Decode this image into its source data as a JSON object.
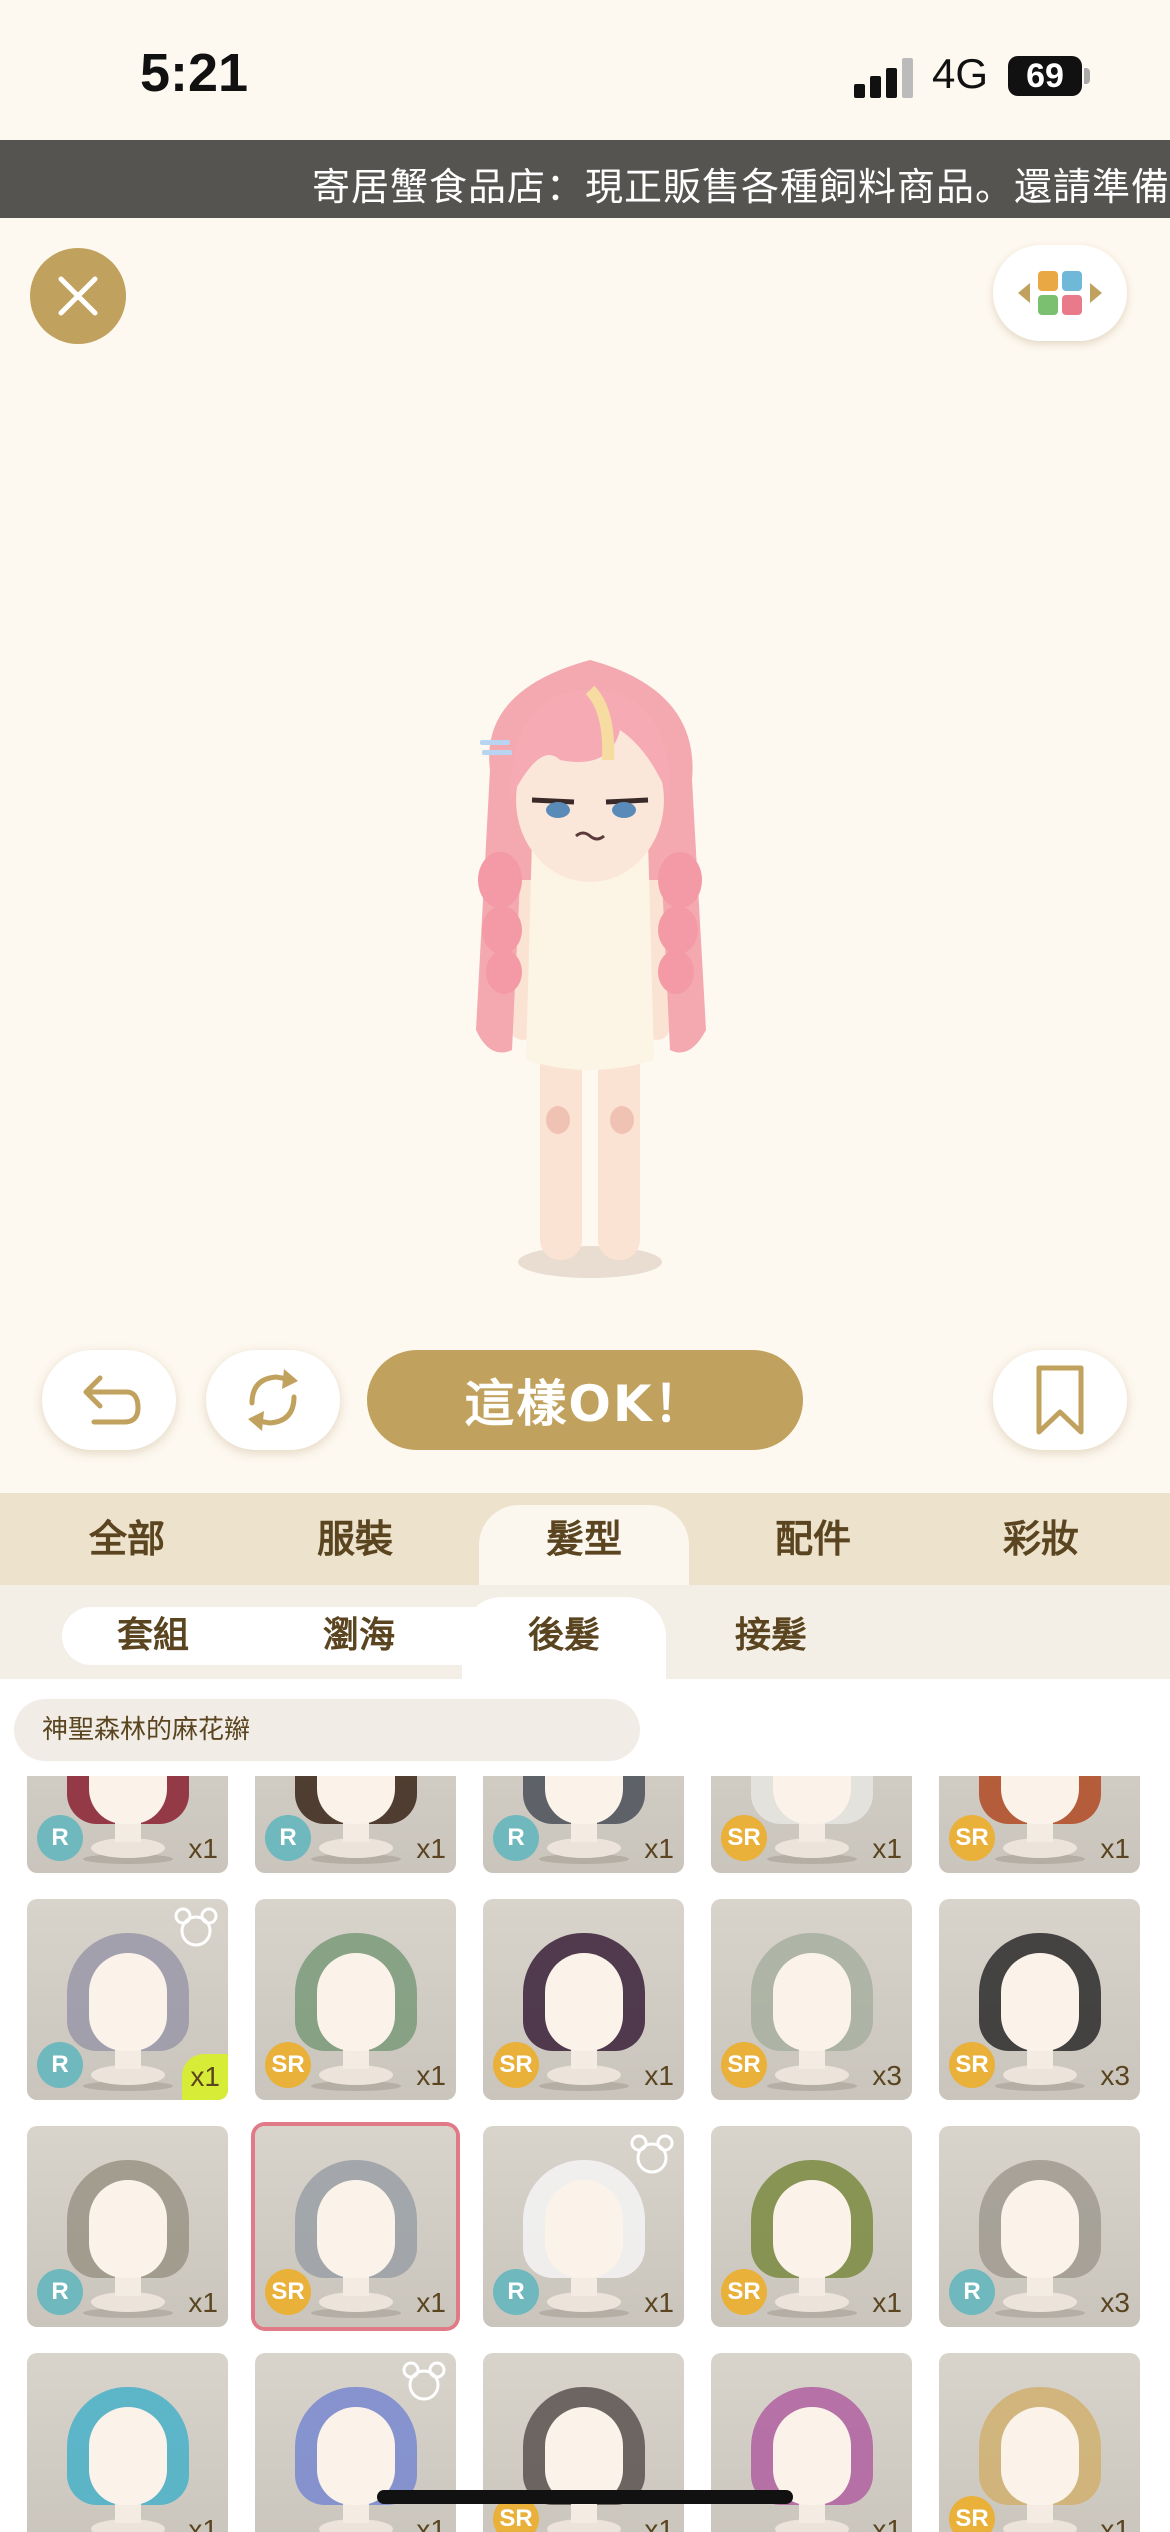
{
  "status": {
    "time": "5:21",
    "network": "4G",
    "battery": "69"
  },
  "ticker": "寄居蟹食品店：現正販售各種飼料商品。還請準備好",
  "actions": {
    "ok_label": "這樣OK！"
  },
  "category_tabs": [
    "全部",
    "服裝",
    "髮型",
    "配件",
    "彩妝"
  ],
  "active_category": "髮型",
  "sub_tabs": [
    "套組",
    "瀏海",
    "後髮",
    "接髮"
  ],
  "active_sub_tab": "後髮",
  "selected_item_name": "神聖森林的麻花辮",
  "items": [
    {
      "rarity": "R",
      "count": "x1",
      "hair": "#8a2030"
    },
    {
      "rarity": "R",
      "count": "x1",
      "hair": "#3a2418"
    },
    {
      "rarity": "R",
      "count": "x1",
      "hair": "#4a5058"
    },
    {
      "rarity": "SR",
      "count": "x1",
      "hair": "#e8e6e2"
    },
    {
      "rarity": "SR",
      "count": "x1",
      "hair": "#b04a22"
    },
    {
      "rarity": "R",
      "count": "x1",
      "hair": "#9a98a8",
      "bear": true,
      "highlight": true
    },
    {
      "rarity": "SR",
      "count": "x1",
      "hair": "#7a9a7a"
    },
    {
      "rarity": "SR",
      "count": "x1",
      "hair": "#3a2038"
    },
    {
      "rarity": "SR",
      "count": "x3",
      "hair": "#a8b0a0"
    },
    {
      "rarity": "SR",
      "count": "x3",
      "hair": "#2a2a2a"
    },
    {
      "rarity": "R",
      "count": "x1",
      "hair": "#9a9486"
    },
    {
      "rarity": "SR",
      "count": "x1",
      "hair": "#9aa0a6",
      "selected": true
    },
    {
      "rarity": "R",
      "count": "x1",
      "hair": "#f4f4f4",
      "bear": true
    },
    {
      "rarity": "SR",
      "count": "x1",
      "hair": "#7a8a40"
    },
    {
      "rarity": "R",
      "count": "x3",
      "hair": "#a09a90"
    },
    {
      "rarity": "",
      "count": "x1",
      "hair": "#48b0c8"
    },
    {
      "rarity": "",
      "count": "x1",
      "hair": "#7888d0",
      "bear": true
    },
    {
      "rarity": "SR",
      "count": "x1",
      "hair": "#5a5250"
    },
    {
      "rarity": "",
      "count": "x1",
      "hair": "#b060a0"
    },
    {
      "rarity": "SR",
      "count": "x1",
      "hair": "#d0b070"
    }
  ],
  "colors": {
    "accent": "#c0a25e",
    "rarity_r": "#6fb8bd",
    "rarity_sr": "#e9b03a",
    "selected_border": "#e07a86"
  },
  "icons": [
    "close-icon",
    "palette-icon",
    "undo-icon",
    "refresh-icon",
    "bookmark-icon",
    "bear-badge-icon"
  ]
}
